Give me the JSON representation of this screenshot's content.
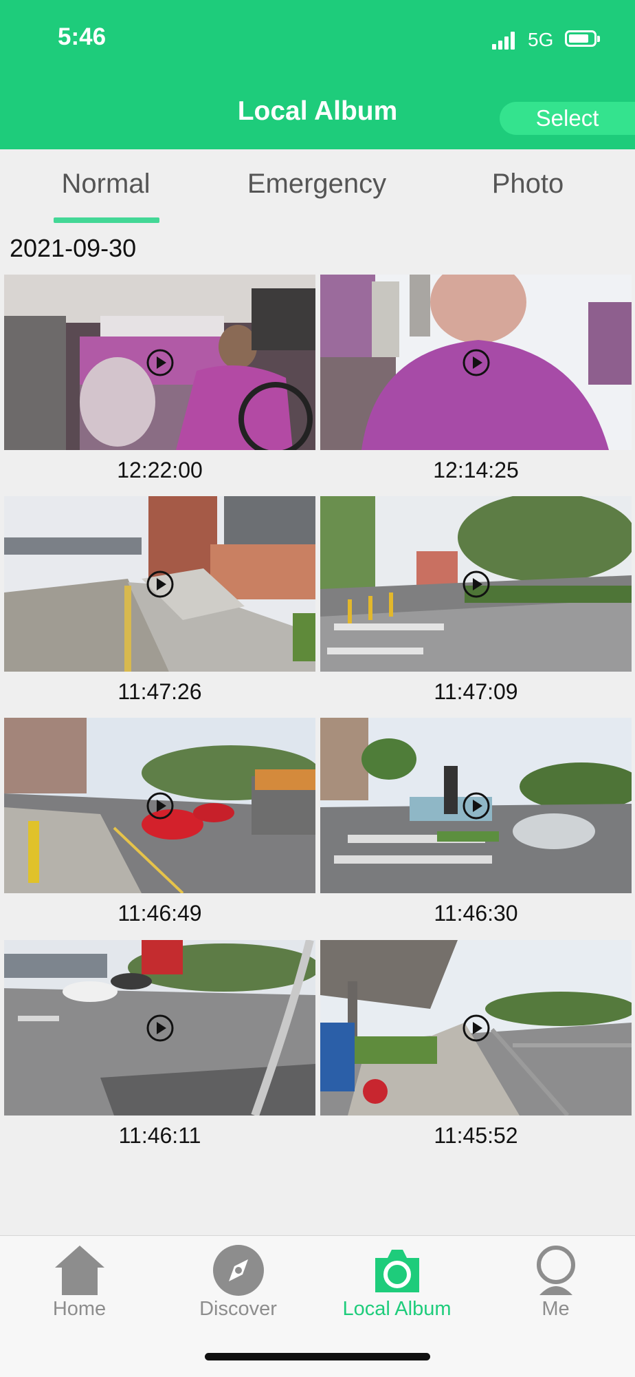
{
  "status_bar": {
    "time": "5:46",
    "network": "5G"
  },
  "header": {
    "title": "Local Album",
    "select_label": "Select"
  },
  "tabs": [
    {
      "label": "Normal",
      "active": true
    },
    {
      "label": "Emergency",
      "active": false
    },
    {
      "label": "Photo",
      "active": false
    }
  ],
  "album": {
    "date": "2021-09-30",
    "items": [
      {
        "time": "12:22:00",
        "scene": "car-interior-driver"
      },
      {
        "time": "12:14:25",
        "scene": "person-purple-shirt"
      },
      {
        "time": "11:47:26",
        "scene": "sidewalk-stairs"
      },
      {
        "time": "11:47:09",
        "scene": "crosswalk-trees"
      },
      {
        "time": "11:46:49",
        "scene": "road-traffic-truck"
      },
      {
        "time": "11:46:30",
        "scene": "intersection-crosswalk"
      },
      {
        "time": "11:46:11",
        "scene": "plaza-road"
      },
      {
        "time": "11:45:52",
        "scene": "overpass-walkway"
      }
    ]
  },
  "tab_bar": [
    {
      "label": "Home",
      "icon": "house-icon",
      "active": false
    },
    {
      "label": "Discover",
      "icon": "compass-icon",
      "active": false
    },
    {
      "label": "Local Album",
      "icon": "camera-icon",
      "active": true
    },
    {
      "label": "Me",
      "icon": "user-icon",
      "active": false
    }
  ],
  "colors": {
    "brand": "#1ecc7b",
    "select_button": "#34e38e",
    "tab_underline": "#43d796",
    "inactive_text": "#8d8d8d"
  }
}
